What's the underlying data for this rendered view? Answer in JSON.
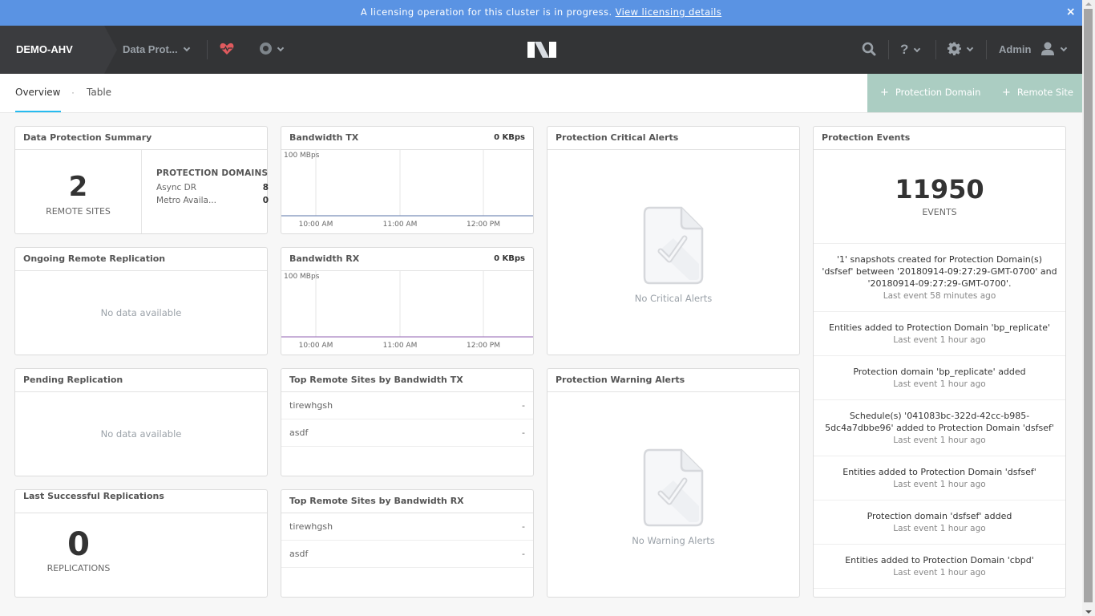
{
  "banner": {
    "message": "A licensing operation for this cluster is in progress.",
    "link": "View licensing details",
    "close": "×"
  },
  "topnav": {
    "cluster_name": "DEMO-AHV",
    "view_menu": "Data Prot...",
    "health_icon": "heart-pulse-icon",
    "alerts_icon": "circle-icon",
    "search_icon": "search-icon",
    "help_label": "?",
    "settings_icon": "gear-icon",
    "user_label": "Admin",
    "user_icon": "user-icon",
    "logo": "N"
  },
  "tabs": {
    "items": [
      {
        "label": "Overview",
        "active": true
      },
      {
        "label": "Table",
        "active": false
      }
    ],
    "separator": "·"
  },
  "actions": {
    "add_protection_domain": "Protection Domain",
    "add_remote_site": "Remote Site",
    "plus": "+"
  },
  "widgets": {
    "summary": {
      "title": "Data Protection Summary",
      "remote_sites_count": "2",
      "remote_sites_label": "REMOTE SITES",
      "pd_title": "PROTECTION DOMAINS",
      "rows": [
        {
          "label": "Async DR",
          "value": "8"
        },
        {
          "label": "Metro Availa...",
          "value": "0"
        }
      ]
    },
    "bandwidth_tx": {
      "title": "Bandwidth TX",
      "current": "0 KBps",
      "ymax_label": "100 MBps",
      "x_labels": [
        "10:00 AM",
        "11:00 AM",
        "12:00 PM"
      ],
      "line_color": "#7b8fb9"
    },
    "bandwidth_rx": {
      "title": "Bandwidth RX",
      "current": "0 KBps",
      "ymax_label": "100 MBps",
      "x_labels": [
        "10:00 AM",
        "11:00 AM",
        "12:00 PM"
      ],
      "line_color": "#a681c0"
    },
    "critical_alerts": {
      "title": "Protection Critical Alerts",
      "empty": "No Critical Alerts"
    },
    "ongoing_replication": {
      "title": "Ongoing Remote Replication",
      "empty": "No data available"
    },
    "pending_replication": {
      "title": "Pending Replication",
      "empty": "No data available"
    },
    "top_tx": {
      "title": "Top Remote Sites by Bandwidth TX",
      "rows": [
        {
          "name": "tirewhgsh",
          "value": "-"
        },
        {
          "name": "asdf",
          "value": "-"
        }
      ]
    },
    "top_rx": {
      "title": "Top Remote Sites by Bandwidth RX",
      "rows": [
        {
          "name": "tirewhgsh",
          "value": "-"
        },
        {
          "name": "asdf",
          "value": "-"
        }
      ]
    },
    "warning_alerts": {
      "title": "Protection Warning Alerts",
      "empty": "No Warning Alerts"
    },
    "last_replications": {
      "title": "Last Successful Replications",
      "count": "0",
      "label": "REPLICATIONS"
    },
    "events": {
      "title": "Protection Events",
      "count": "11950",
      "label": "EVENTS",
      "items": [
        {
          "text": "'1' snapshots created for Protection Domain(s) 'dsfsef' between '20180914-09:27:29-GMT-0700' and '20180914-09:27:29-GMT-0700'.",
          "sub": "Last event 58 minutes ago"
        },
        {
          "text": "Entities added to Protection Domain 'bp_replicate'",
          "sub": "Last event 1 hour ago"
        },
        {
          "text": "Protection domain 'bp_replicate' added",
          "sub": "Last event 1 hour ago"
        },
        {
          "text": "Schedule(s) '041083bc-322d-42cc-b985-5dc4a7dbbe96' added to Protection Domain 'dsfsef'",
          "sub": "Last event 1 hour ago"
        },
        {
          "text": "Entities added to Protection Domain 'dsfsef'",
          "sub": "Last event 1 hour ago"
        },
        {
          "text": "Protection domain 'dsfsef' added",
          "sub": "Last event 1 hour ago"
        },
        {
          "text": "Entities added to Protection Domain 'cbpd'",
          "sub": "Last event 1 hour ago"
        }
      ]
    }
  }
}
